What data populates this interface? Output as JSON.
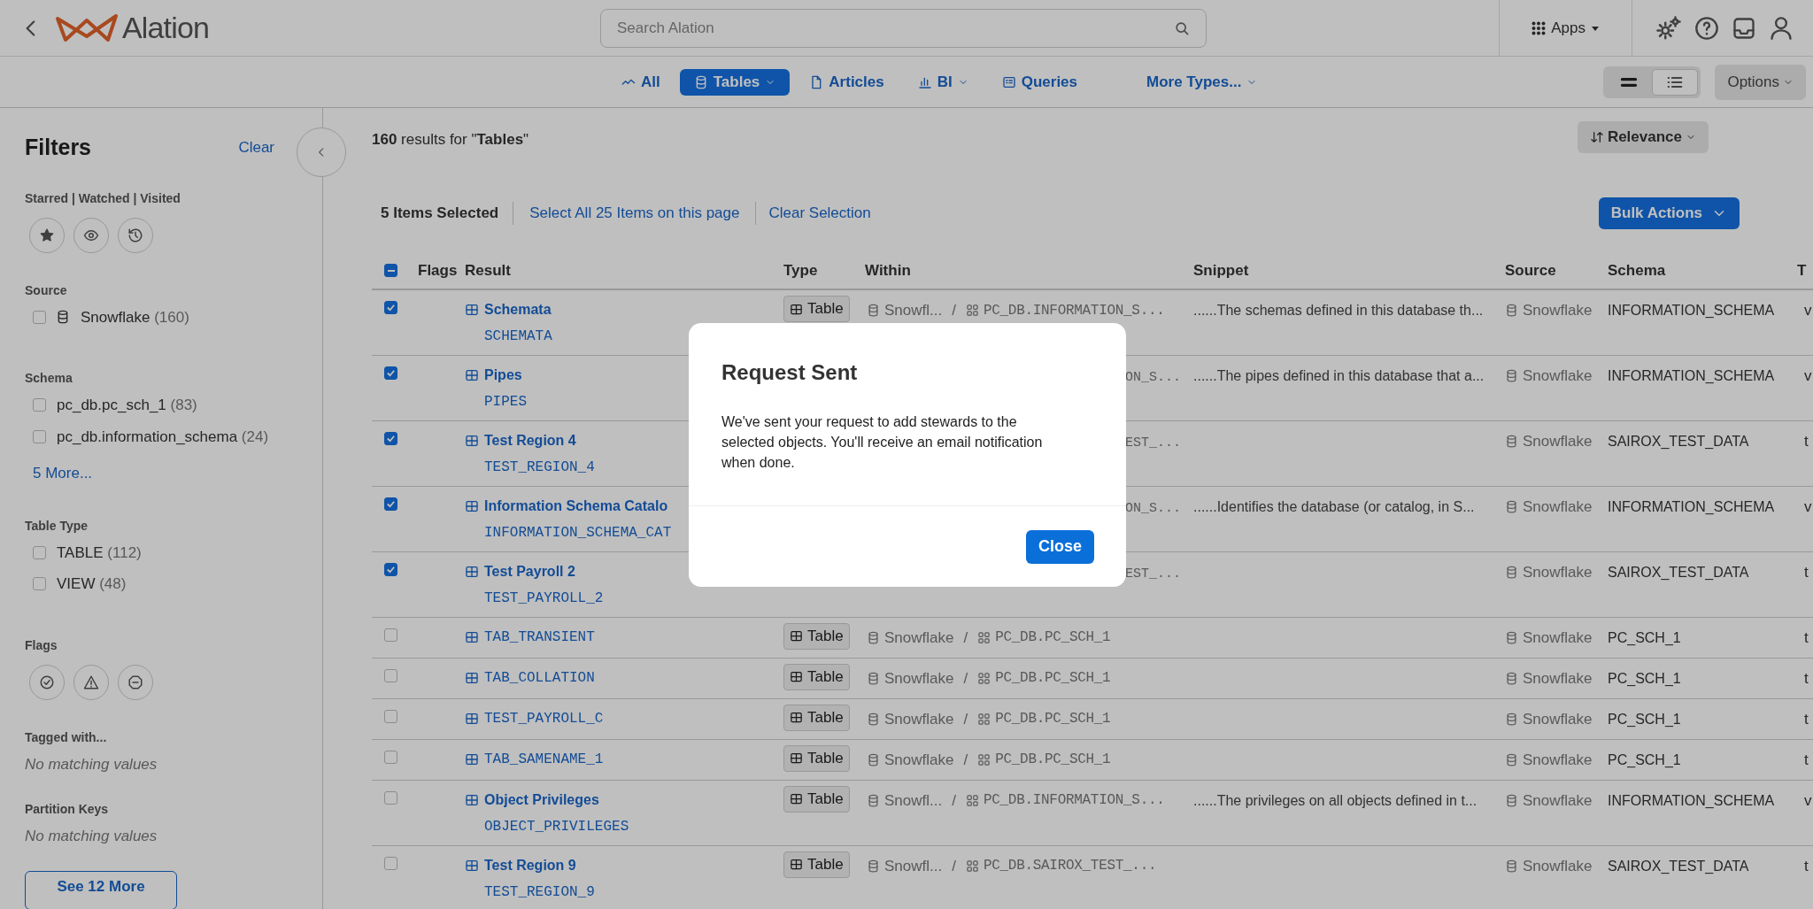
{
  "header": {
    "logo_text": "Alation",
    "search": {
      "placeholder": "Search Alation"
    },
    "apps_label": "Apps"
  },
  "nav": {
    "tabs": [
      {
        "label": "All",
        "kind": "all",
        "dropdown": false,
        "selected": false
      },
      {
        "label": "Tables",
        "kind": "tables",
        "dropdown": true,
        "selected": true
      },
      {
        "label": "Articles",
        "kind": "articles",
        "dropdown": false,
        "selected": false
      },
      {
        "label": "BI",
        "kind": "bi",
        "dropdown": true,
        "selected": false
      },
      {
        "label": "Queries",
        "kind": "queries",
        "dropdown": false,
        "selected": false
      },
      {
        "label": "More Types...",
        "kind": "more",
        "dropdown": true,
        "selected": false
      }
    ],
    "view_toggle": [
      {
        "kind": "compact",
        "selected": false
      },
      {
        "kind": "list",
        "selected": true
      }
    ],
    "options_label": "Options"
  },
  "sidebar": {
    "title": "Filters",
    "clear": "Clear",
    "sections": [
      {
        "title": "Starred | Watched | Visited",
        "kind": "activity_toggles"
      },
      {
        "title": "Source",
        "kind": "checklist",
        "items": [
          {
            "label": "Snowflake",
            "count": "(160)",
            "kind": "source",
            "checked": false
          }
        ]
      },
      {
        "title": "Schema",
        "kind": "checklist",
        "items": [
          {
            "label": "pc_db.pc_sch_1",
            "count": "(83)",
            "kind": "plain",
            "checked": false
          },
          {
            "label": "pc_db.information_schema",
            "count": "(24)",
            "kind": "plain",
            "checked": false
          }
        ],
        "more": "5 More..."
      },
      {
        "title": "Table Type",
        "kind": "checklist",
        "items": [
          {
            "label": "TABLE",
            "count": "(112)",
            "kind": "plain",
            "checked": false
          },
          {
            "label": "VIEW",
            "count": "(48)",
            "kind": "plain",
            "checked": false
          }
        ]
      },
      {
        "title": "Flags",
        "kind": "flag_toggles"
      },
      {
        "title": "Tagged with...",
        "kind": "empty",
        "note": "No matching values"
      },
      {
        "title": "Partition Keys",
        "kind": "empty",
        "note": "No matching values"
      }
    ],
    "see_more": "See 12 More"
  },
  "results": {
    "summary": "**160** results for \"**Tables**\"",
    "sort": "Relevance",
    "selected_count": "5 Items Selected",
    "select_all": "Select All 25 Items on this page",
    "clear_selection": "Clear Selection",
    "bulk_actions": "Bulk Actions"
  },
  "table": {
    "select_all_indeterminate": true,
    "columns": [
      "Flags",
      "Result",
      "Type",
      "Within",
      "Snippet",
      "Source",
      "Schema",
      "T"
    ],
    "rows": [
      {
        "checked": true,
        "title": "Schemata",
        "code": "SCHEMATA",
        "type": "Table",
        "within": {
          "source": "Snowfl...",
          "separator": "/",
          "path": "PC_DB.INFORMATION_S..."
        },
        "snippet": "......The schemas defined in this database th...",
        "source": "Snowflake",
        "schema": "INFORMATION_SCHEMA",
        "column_9": "v"
      },
      {
        "checked": true,
        "title": "Pipes",
        "code": "PIPES",
        "within": {
          "fragment": "ON_S..."
        },
        "snippet": "......The pipes defined in this database that a...",
        "source": "Snowflake",
        "schema": "INFORMATION_SCHEMA",
        "column_9": "v"
      },
      {
        "checked": true,
        "title": "Test Region 4",
        "code": "TEST_REGION_4",
        "within": {
          "fragment": "EST_..."
        },
        "source": "Snowflake",
        "schema": "SAIROX_TEST_DATA",
        "column_9": "t"
      },
      {
        "checked": true,
        "title": "Information Schema Catalo",
        "code": "INFORMATION_SCHEMA_CAT",
        "within": {
          "fragment": "ON_S..."
        },
        "snippet": "......Identifies the database (or catalog, in S...",
        "source": "Snowflake",
        "schema": "INFORMATION_SCHEMA",
        "column_9": "v"
      },
      {
        "checked": true,
        "title": "Test Payroll 2",
        "code": "TEST_PAYROLL_2",
        "within": {
          "fragment": "EST_..."
        },
        "source": "Snowflake",
        "schema": "SAIROX_TEST_DATA",
        "column_9": "t"
      },
      {
        "checked": false,
        "code": "TAB_TRANSIENT",
        "type": "Table",
        "within": {
          "source": "Snowflake",
          "separator": "/",
          "path": "PC_DB.PC_SCH_1"
        },
        "source": "Snowflake",
        "schema": "PC_SCH_1",
        "column_9": "t"
      },
      {
        "checked": false,
        "code": "TAB_COLLATION",
        "type": "Table",
        "within": {
          "source": "Snowflake",
          "separator": "/",
          "path": "PC_DB.PC_SCH_1"
        },
        "source": "Snowflake",
        "schema": "PC_SCH_1",
        "column_9": "t"
      },
      {
        "checked": false,
        "code": "TEST_PAYROLL_C",
        "type": "Table",
        "within": {
          "source": "Snowflake",
          "separator": "/",
          "path": "PC_DB.PC_SCH_1"
        },
        "source": "Snowflake",
        "schema": "PC_SCH_1",
        "column_9": "t"
      },
      {
        "checked": false,
        "code": "TAB_SAMENAME_1",
        "type": "Table",
        "within": {
          "source": "Snowflake",
          "separator": "/",
          "path": "PC_DB.PC_SCH_1"
        },
        "source": "Snowflake",
        "schema": "PC_SCH_1",
        "column_9": "t"
      },
      {
        "checked": false,
        "title": "Object Privileges",
        "code": "OBJECT_PRIVILEGES",
        "type": "Table",
        "within": {
          "source": "Snowfl...",
          "separator": "/",
          "path": "PC_DB.INFORMATION_S..."
        },
        "snippet": "......The privileges on all objects defined in t...",
        "source": "Snowflake",
        "schema": "INFORMATION_SCHEMA",
        "column_9": "v"
      },
      {
        "checked": false,
        "title": "Test Region 9",
        "code": "TEST_REGION_9",
        "type": "Table",
        "within": {
          "source": "Snowfl...",
          "separator": "/",
          "path": "PC_DB.SAIROX_TEST_..."
        },
        "source": "Snowflake",
        "schema": "SAIROX_TEST_DATA",
        "column_9": "t"
      }
    ]
  },
  "dialog": {
    "title": "Request Sent",
    "message": "We've sent your request to add stewards to the selected objects. You'll receive an email notification when done.",
    "button": "Close"
  }
}
